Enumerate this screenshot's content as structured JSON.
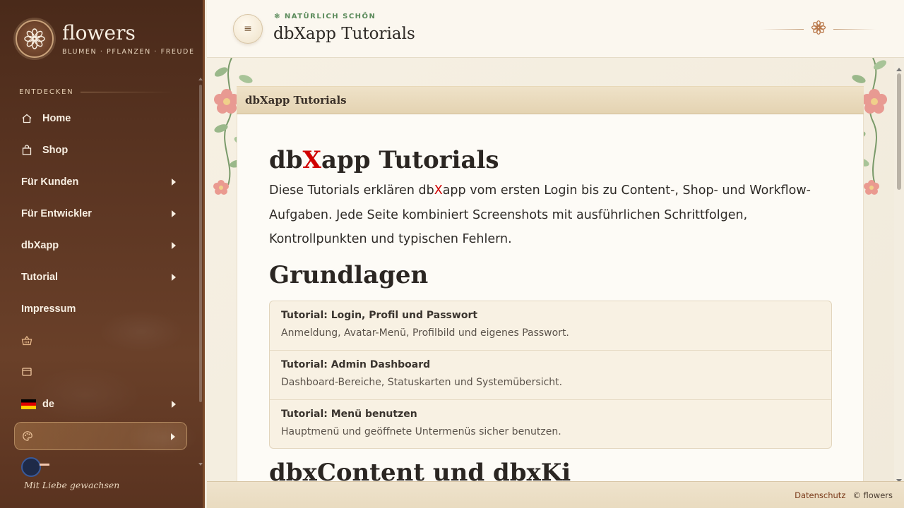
{
  "sidebar": {
    "brand_name": "flowers",
    "brand_tag": "BLUMEN · PFLANZEN · FREUDE",
    "section_label": "ENTDECKEN",
    "items": [
      {
        "label": "Home",
        "icon": "home-icon"
      },
      {
        "label": "Shop",
        "icon": "shopping-bag-icon"
      },
      {
        "label": "Für Kunden",
        "has_submenu": true
      },
      {
        "label": "Für Entwickler",
        "has_submenu": true
      },
      {
        "label": "dbXapp",
        "has_submenu": true
      },
      {
        "label": "Tutorial",
        "has_submenu": true
      },
      {
        "label": "Impressum"
      }
    ],
    "basket_icon": "basket-icon",
    "window_icon": "window-icon",
    "language": {
      "label": "de",
      "flag": "germany-flag-icon"
    },
    "theme_icon": "palette-icon",
    "footer_text": "Mit Liebe gewachsen"
  },
  "header": {
    "kicker": "❃ NATÜRLICH SCHÖN",
    "title": "dbXapp Tutorials",
    "menu_icon": "≡"
  },
  "main": {
    "panel_title": "dbXapp Tutorials",
    "h1_pre": "db",
    "h1_x": "X",
    "h1_post": "app Tutorials",
    "lead_pre": "Diese Tutorials erklären db",
    "lead_x": "X",
    "lead_post": "app vom ersten Login bis zu Content-, Shop- und Workflow-Aufgaben. Jede Seite kombiniert Screenshots mit ausführlichen Schrittfolgen, Kontrollpunkten und typischen Fehlern.",
    "section_title": "Grundlagen",
    "tutorials": [
      {
        "title": "Tutorial: Login, Profil und Passwort",
        "desc": "Anmeldung, Avatar-Menü, Profilbild und eigenes Passwort."
      },
      {
        "title": "Tutorial: Admin Dashboard",
        "desc": "Dashboard-Bereiche, Statuskarten und Systemübersicht."
      },
      {
        "title": "Tutorial: Menü benutzen",
        "desc": "Hauptmenü und geöffnete Untermenüs sicher benutzen."
      }
    ],
    "next_section_title": "dbxContent und dbxKi"
  },
  "footer": {
    "privacy": "Datenschutz",
    "copyright": "© flowers"
  },
  "colors": {
    "sidebar_bg": "#5b3522",
    "accent_red": "#d00000",
    "kicker_green": "#5a8a5a",
    "link_brown": "#7a3a1a"
  }
}
